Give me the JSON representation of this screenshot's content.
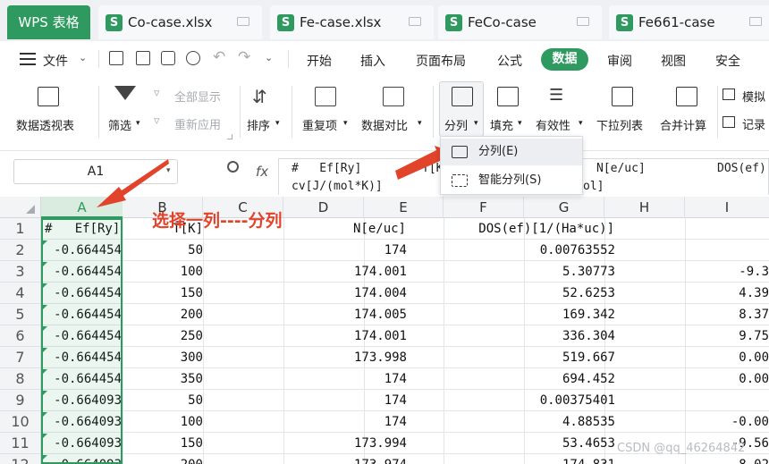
{
  "app": {
    "name": "WPS 表格"
  },
  "file_tabs": [
    {
      "name": "Co-case.xlsx"
    },
    {
      "name": "Fe-case.xlsx"
    },
    {
      "name": "FeCo-case"
    },
    {
      "name": "Fe661-case"
    }
  ],
  "file_icon_letter": "S",
  "menu": {
    "file": "文件",
    "items": [
      "开始",
      "插入",
      "页面布局",
      "公式",
      "数据",
      "审阅",
      "视图",
      "安全"
    ],
    "active": "数据"
  },
  "toolbar": {
    "pivot": "数据透视表",
    "filter": "筛选",
    "show_all": "全部显示",
    "reapply": "重新应用",
    "sort": "排序",
    "duplicates": "重复项",
    "compare": "数据对比",
    "split": "分列",
    "fill": "填充",
    "validity": "有效性",
    "dropdown_list": "下拉列表",
    "merge_calc": "合并计算",
    "simulate": "模拟",
    "record": "记录"
  },
  "formula_bar": {
    "cell_ref": "A1",
    "fx": "fx",
    "line1_a": "#   Ef[Ry]",
    "line1_b": "T[K",
    "line1_c": "N[e/uc]",
    "line1_d": "DOS(ef)",
    "line2_a": "cv[J/(mol*K)]",
    "line2_b": "ol]"
  },
  "dropdown": {
    "items": [
      {
        "label": "分列(E)"
      },
      {
        "label": "智能分列(S)"
      }
    ]
  },
  "grid": {
    "columns": [
      "A",
      "B",
      "C",
      "D",
      "E",
      "F",
      "G",
      "H",
      "I"
    ],
    "rows": [
      {
        "n": "1",
        "a": "#   Ef[Ry]",
        "b": "T[K]",
        "e": "N[e/uc]",
        "f": "DOS(ef)[1/(Ha*uc)]",
        "g": "",
        "i": ""
      },
      {
        "n": "2",
        "a": "-0.664454",
        "b": "50",
        "e": "174",
        "f": "",
        "g": "0.00763552",
        "i": ""
      },
      {
        "n": "3",
        "a": "-0.664454",
        "b": "100",
        "e": "174.001",
        "f": "",
        "g": "5.30773",
        "i": "-9.3"
      },
      {
        "n": "4",
        "a": "-0.664454",
        "b": "150",
        "e": "174.004",
        "f": "",
        "g": "52.6253",
        "i": "4.39"
      },
      {
        "n": "5",
        "a": "-0.664454",
        "b": "200",
        "e": "174.005",
        "f": "",
        "g": "169.342",
        "i": "8.37"
      },
      {
        "n": "6",
        "a": "-0.664454",
        "b": "250",
        "e": "174.001",
        "f": "",
        "g": "336.304",
        "i": "9.75"
      },
      {
        "n": "7",
        "a": "-0.664454",
        "b": "300",
        "e": "173.998",
        "f": "",
        "g": "519.667",
        "i": "0.00"
      },
      {
        "n": "8",
        "a": "-0.664454",
        "b": "350",
        "e": "174",
        "f": "",
        "g": "694.452",
        "i": "0.00"
      },
      {
        "n": "9",
        "a": "-0.664093",
        "b": "50",
        "e": "174",
        "f": "",
        "g": "0.00375401",
        "i": ""
      },
      {
        "n": "10",
        "a": "-0.664093",
        "b": "100",
        "e": "174",
        "f": "",
        "g": "4.88535",
        "i": "-0.00"
      },
      {
        "n": "11",
        "a": "-0.664093",
        "b": "150",
        "e": "173.994",
        "f": "",
        "g": "53.4653",
        "i": "-9.56"
      },
      {
        "n": "12",
        "a": "-0.664093",
        "b": "200",
        "e": "173.974",
        "f": "",
        "g": "174.831",
        "i": "8.02"
      }
    ]
  },
  "annotation": "选择一列----分列",
  "watermark": "CSDN @qq_46264842",
  "colors": {
    "accent": "#2e9a5f",
    "arrow": "#e2432b"
  }
}
